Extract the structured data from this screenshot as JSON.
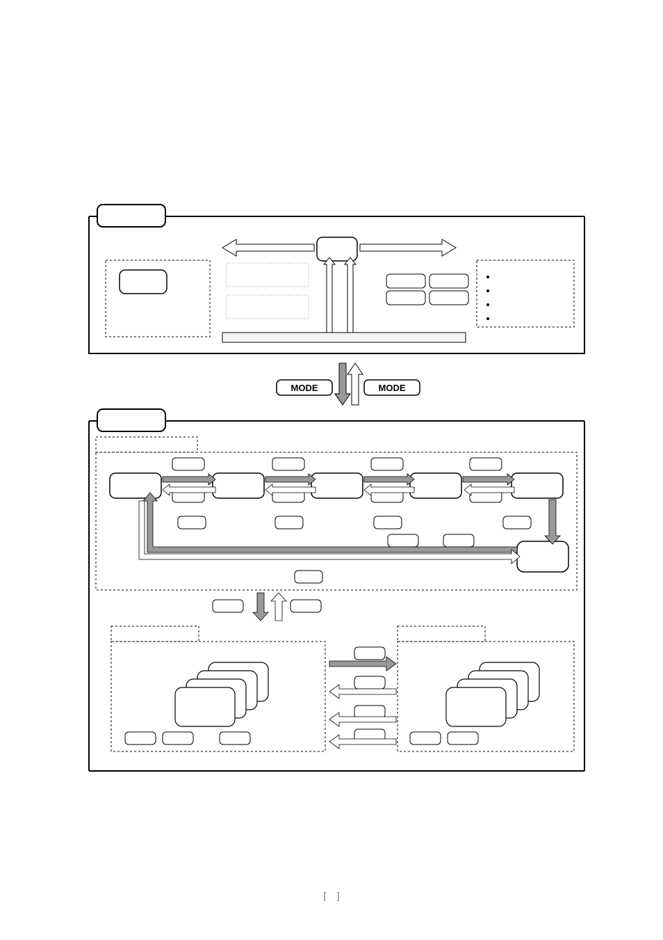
{
  "page": {
    "page_number_left_bracket": "[",
    "page_number_right_bracket": "]"
  },
  "top_panel": {
    "tab_label": "",
    "left_dashed_box": {
      "inner_box_label": ""
    },
    "center_top_box_label": "",
    "center_dotted_box1_label": "",
    "center_dotted_box2_label": "",
    "bottom_bar_label": "",
    "right_box_cluster": {
      "a": "",
      "b": "",
      "c": "",
      "d": ""
    },
    "right_dashed_box": {
      "b1": "",
      "b2": "",
      "b3": "",
      "b4": ""
    }
  },
  "middle": {
    "mode_label_left": "MODE",
    "mode_label_right": "MODE"
  },
  "bottom_panel": {
    "tab_label": "",
    "upper_region_label": "",
    "row_nodes": {
      "n1": "",
      "n2": "",
      "n3": "",
      "n4": "",
      "n5": ""
    },
    "row_small_nodes": {
      "s1": "",
      "s2": "",
      "s3": "",
      "s4": "",
      "s5": "",
      "s6": "",
      "s7": "",
      "s8": "",
      "s9": "",
      "s10": "",
      "s11": "",
      "s12": ""
    },
    "mid_small_row": {
      "m1": "",
      "m2": "",
      "m3": "",
      "m4": ""
    },
    "below_small_pair": {
      "b1": "",
      "b2": ""
    },
    "right_branch_box": "",
    "center_lone_box": "",
    "transition_pair": {
      "l": "",
      "r": ""
    },
    "lower_left_region_label": "",
    "lower_right_region_label": "",
    "stack_card_labels": {
      "l1": "",
      "l2": "",
      "l3": "",
      "l4": "",
      "r1": "",
      "r2": "",
      "r3": "",
      "r4": ""
    },
    "left_footer_buttons": {
      "a": "",
      "b": "",
      "c": ""
    },
    "right_footer_buttons": {
      "a": "",
      "b": ""
    },
    "center_column_buttons": {
      "a": "",
      "b": "",
      "c": "",
      "d": ""
    }
  }
}
